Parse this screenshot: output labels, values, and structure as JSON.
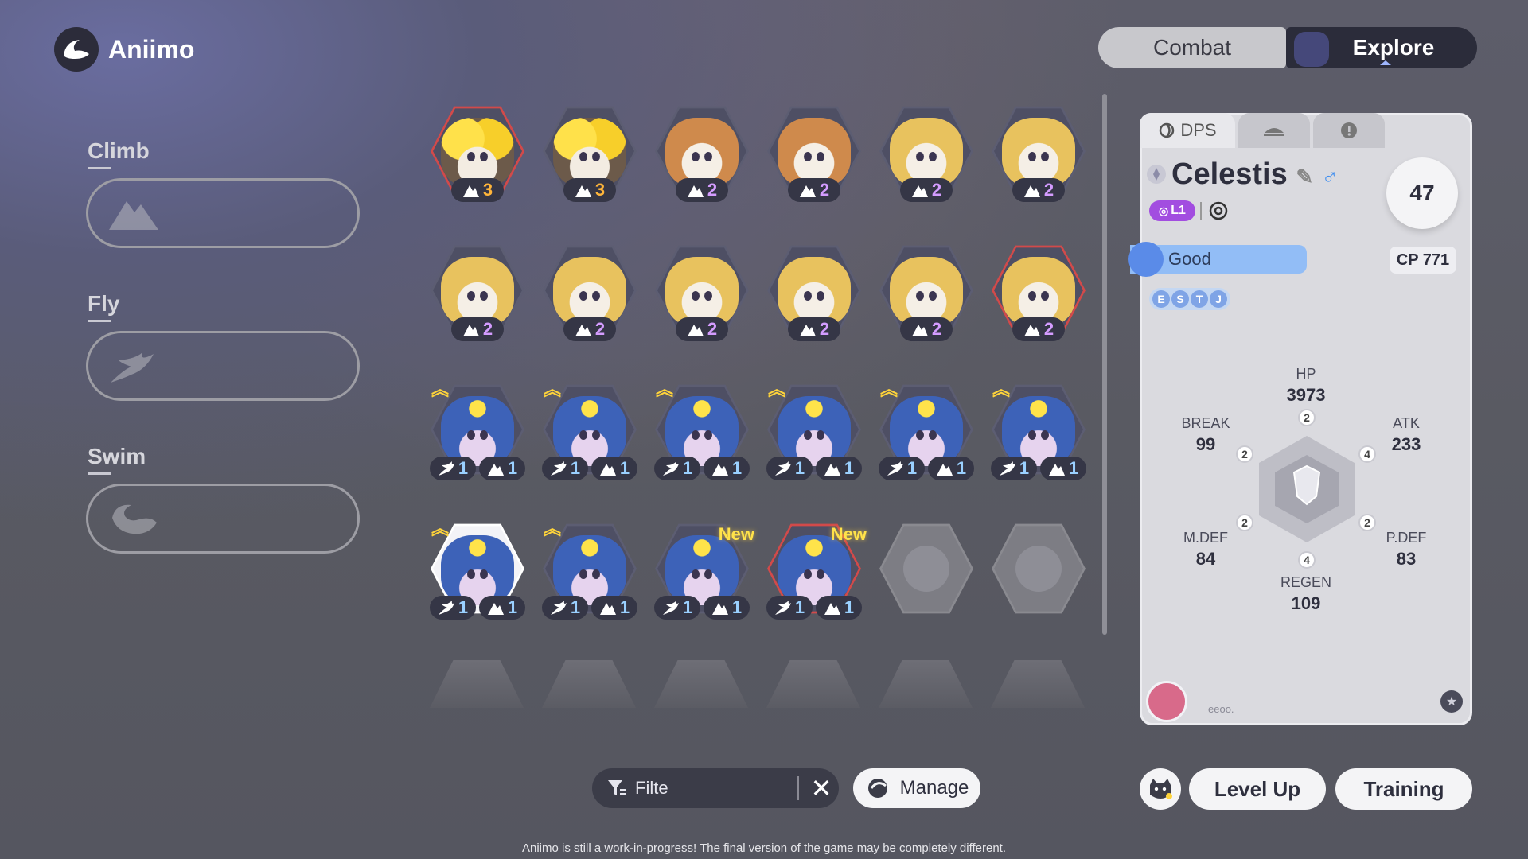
{
  "header": {
    "app_title": "Aniimo",
    "modes": [
      {
        "label": "Combat",
        "active": false
      },
      {
        "label": "Explore",
        "active": true
      }
    ]
  },
  "skills": [
    {
      "label": "Climb",
      "icon": "mountain-icon"
    },
    {
      "label": "Fly",
      "icon": "wing-icon"
    },
    {
      "label": "Swim",
      "icon": "wave-icon"
    }
  ],
  "grid": {
    "rows": [
      [
        {
          "creature": "fox-yellow-crest",
          "frame": "red",
          "badges": [
            {
              "icon": "mountain-icon",
              "value": "3",
              "tone": "orange"
            }
          ]
        },
        {
          "creature": "fox-yellow-crest",
          "frame": "plain",
          "badges": [
            {
              "icon": "mountain-icon",
              "value": "3",
              "tone": "orange"
            }
          ]
        },
        {
          "creature": "fox-orange",
          "frame": "plain",
          "badges": [
            {
              "icon": "mountain-icon",
              "value": "2",
              "tone": "purple"
            }
          ]
        },
        {
          "creature": "fox-orange",
          "frame": "plain",
          "badges": [
            {
              "icon": "mountain-icon",
              "value": "2",
              "tone": "purple"
            }
          ]
        },
        {
          "creature": "fox-light",
          "frame": "plain",
          "badges": [
            {
              "icon": "mountain-icon",
              "value": "2",
              "tone": "purple"
            }
          ]
        },
        {
          "creature": "fox-light",
          "frame": "plain",
          "badges": [
            {
              "icon": "mountain-icon",
              "value": "2",
              "tone": "purple"
            }
          ]
        }
      ],
      [
        {
          "creature": "fox-light",
          "frame": "plain",
          "badges": [
            {
              "icon": "mountain-icon",
              "value": "2",
              "tone": "purple"
            }
          ]
        },
        {
          "creature": "fox-light",
          "frame": "plain",
          "badges": [
            {
              "icon": "mountain-icon",
              "value": "2",
              "tone": "purple"
            }
          ]
        },
        {
          "creature": "fox-light",
          "frame": "plain",
          "badges": [
            {
              "icon": "mountain-icon",
              "value": "2",
              "tone": "purple"
            }
          ]
        },
        {
          "creature": "fox-light",
          "frame": "plain",
          "badges": [
            {
              "icon": "mountain-icon",
              "value": "2",
              "tone": "purple"
            }
          ]
        },
        {
          "creature": "fox-light",
          "frame": "plain",
          "badges": [
            {
              "icon": "mountain-icon",
              "value": "2",
              "tone": "purple"
            }
          ]
        },
        {
          "creature": "fox-light",
          "frame": "red",
          "badges": [
            {
              "icon": "mountain-icon",
              "value": "2",
              "tone": "purple"
            }
          ]
        }
      ],
      [
        {
          "creature": "blue-star",
          "frame": "plain",
          "up": true,
          "badges": [
            {
              "icon": "wing-icon",
              "value": "1",
              "tone": "blue"
            },
            {
              "icon": "mountain-icon",
              "value": "1",
              "tone": "blue"
            }
          ]
        },
        {
          "creature": "blue-star",
          "frame": "plain",
          "up": true,
          "badges": [
            {
              "icon": "wing-icon",
              "value": "1",
              "tone": "blue"
            },
            {
              "icon": "mountain-icon",
              "value": "1",
              "tone": "blue"
            }
          ]
        },
        {
          "creature": "blue-star",
          "frame": "plain",
          "up": true,
          "badges": [
            {
              "icon": "wing-icon",
              "value": "1",
              "tone": "blue"
            },
            {
              "icon": "mountain-icon",
              "value": "1",
              "tone": "blue"
            }
          ]
        },
        {
          "creature": "blue-star",
          "frame": "plain",
          "up": true,
          "badges": [
            {
              "icon": "wing-icon",
              "value": "1",
              "tone": "blue"
            },
            {
              "icon": "mountain-icon",
              "value": "1",
              "tone": "blue"
            }
          ]
        },
        {
          "creature": "blue-star",
          "frame": "plain",
          "up": true,
          "badges": [
            {
              "icon": "wing-icon",
              "value": "1",
              "tone": "blue"
            },
            {
              "icon": "mountain-icon",
              "value": "1",
              "tone": "blue"
            }
          ]
        },
        {
          "creature": "blue-star",
          "frame": "plain",
          "up": true,
          "badges": [
            {
              "icon": "wing-icon",
              "value": "1",
              "tone": "blue"
            },
            {
              "icon": "mountain-icon",
              "value": "1",
              "tone": "blue"
            }
          ]
        }
      ],
      [
        {
          "creature": "blue-star",
          "frame": "selected",
          "up": true,
          "badges": [
            {
              "icon": "wing-icon",
              "value": "1",
              "tone": "blue"
            },
            {
              "icon": "mountain-icon",
              "value": "1",
              "tone": "blue"
            }
          ]
        },
        {
          "creature": "blue-star",
          "frame": "plain",
          "up": true,
          "badges": [
            {
              "icon": "wing-icon",
              "value": "1",
              "tone": "blue"
            },
            {
              "icon": "mountain-icon",
              "value": "1",
              "tone": "blue"
            }
          ]
        },
        {
          "creature": "blue-star",
          "frame": "plain",
          "new_label": "New",
          "badges": [
            {
              "icon": "wing-icon",
              "value": "1",
              "tone": "blue"
            },
            {
              "icon": "mountain-icon",
              "value": "1",
              "tone": "blue"
            }
          ]
        },
        {
          "creature": "blue-star",
          "frame": "red",
          "new_label": "New",
          "badges": [
            {
              "icon": "wing-icon",
              "value": "1",
              "tone": "blue"
            },
            {
              "icon": "mountain-icon",
              "value": "1",
              "tone": "blue"
            }
          ]
        },
        {
          "creature": "empty",
          "frame": "empty",
          "badges": []
        },
        {
          "creature": "empty",
          "frame": "empty",
          "badges": []
        }
      ]
    ]
  },
  "detail": {
    "tabs": [
      {
        "label": "DPS",
        "icon": "dps-icon"
      },
      {
        "label": "",
        "icon": "dish-icon"
      },
      {
        "label": "",
        "icon": "info-icon"
      }
    ],
    "name": "Celestis",
    "gender": "♂",
    "level": "47",
    "tag": "L1",
    "mood": "Good",
    "cp": "CP 771",
    "personality": [
      "E",
      "S",
      "T",
      "J"
    ],
    "stats": {
      "hp": {
        "label": "HP",
        "value": "3973",
        "points": "2"
      },
      "atk": {
        "label": "ATK",
        "value": "233",
        "points": "4"
      },
      "pdef": {
        "label": "P.DEF",
        "value": "83",
        "points": "2"
      },
      "regen": {
        "label": "REGEN",
        "value": "109",
        "points": "4"
      },
      "mdef": {
        "label": "M.DEF",
        "value": "84",
        "points": "2"
      },
      "break": {
        "label": "BREAK",
        "value": "99",
        "points": "2"
      }
    },
    "footer_code": "eeoo."
  },
  "bottom": {
    "filter_placeholder": "Filte",
    "manage_label": "Manage",
    "level_up_label": "Level Up",
    "training_label": "Training"
  },
  "notice": "Aniimo is still a work-in-progress! The final version of the game may be completely different.",
  "colors": {
    "accent_purple": "#a24de0",
    "mood_blue": "#92bdf6",
    "alert_red": "#d24a4a",
    "new_yellow": "#ffe24a"
  }
}
